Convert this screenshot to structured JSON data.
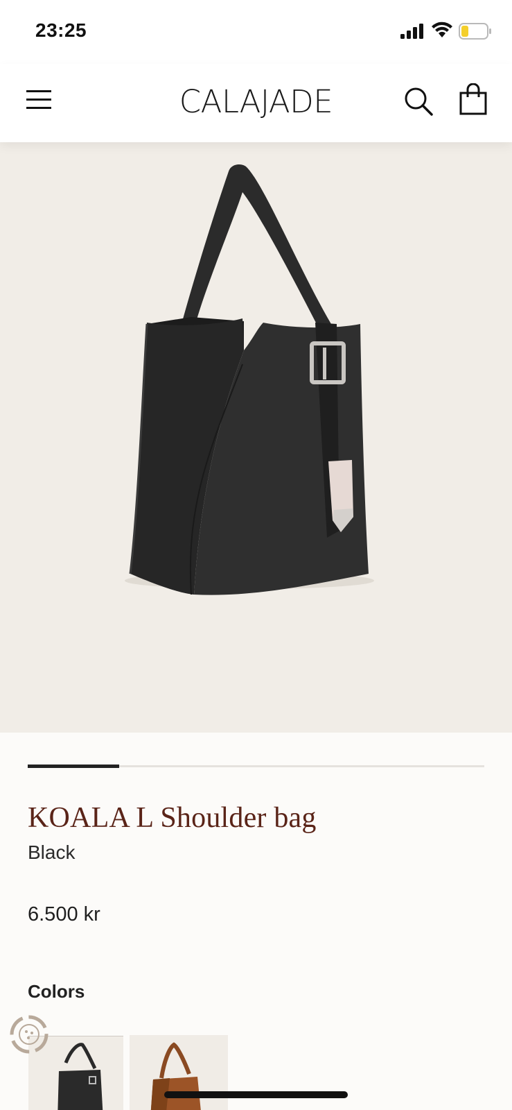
{
  "status_bar": {
    "time": "23:25",
    "icons": [
      "cellular-signal-icon",
      "wifi-icon",
      "battery-low-icon"
    ]
  },
  "header": {
    "brand": "CALAJADE",
    "icons": [
      "hamburger-menu-icon",
      "search-icon",
      "shopping-bag-icon"
    ]
  },
  "gallery": {
    "image": "product-photo-black-shoulder-bag",
    "progress_fraction": 0.2
  },
  "product": {
    "name": "KOALA L Shoulder bag",
    "variant": "Black",
    "price": "6.500 kr"
  },
  "colors": {
    "label": "Colors",
    "options": [
      "black",
      "cognac"
    ]
  },
  "theme": {
    "accent_title": "#5a2418",
    "hero_background": "#f1ede7",
    "page_background": "#fcfbf9"
  }
}
